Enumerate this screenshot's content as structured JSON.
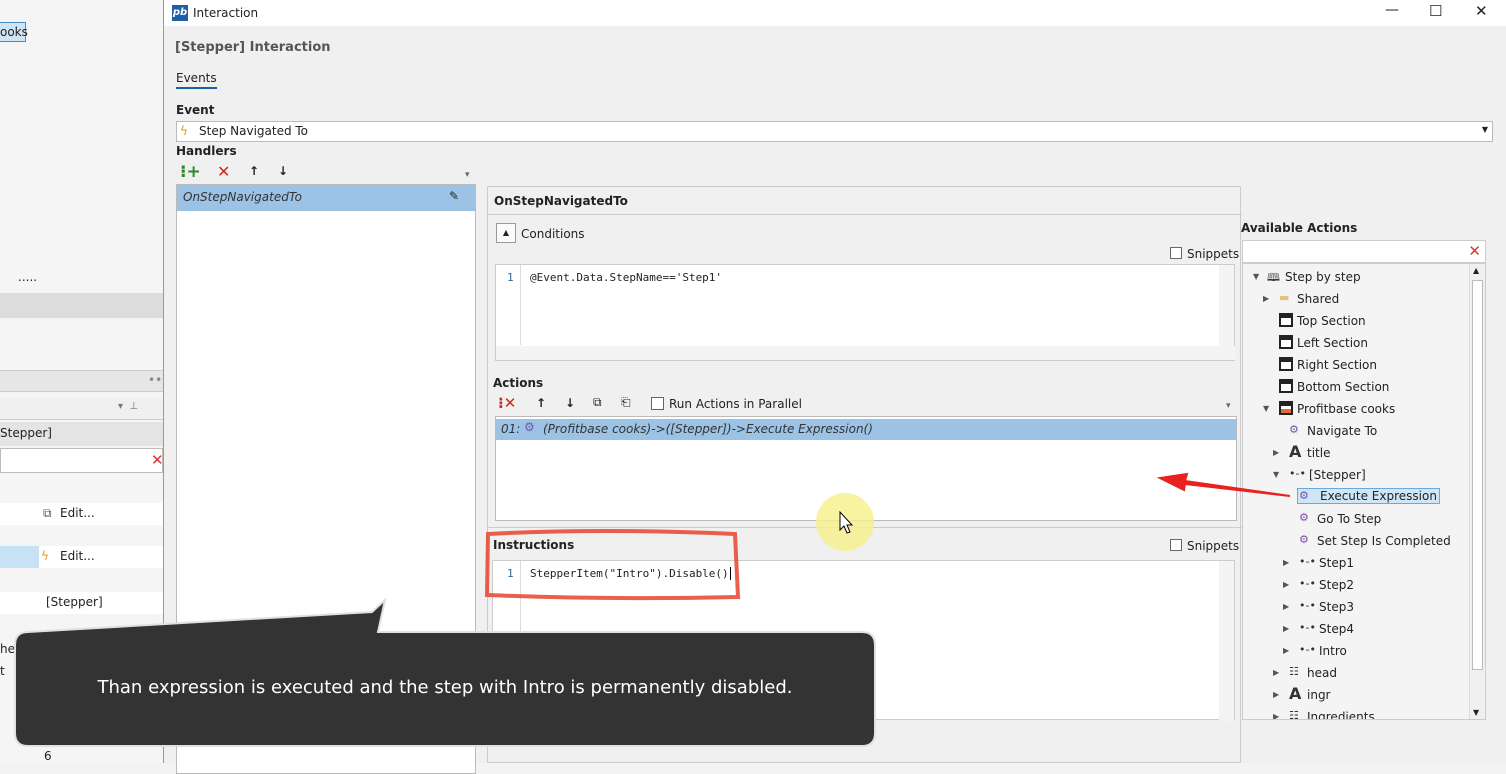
{
  "background_app": {
    "tab_label": "ooks",
    "dots": ".....",
    "grip": "••",
    "panel_header": "Stepper]",
    "property_rows": [
      {
        "value": "Edit...",
        "icon": "copy-icon"
      },
      {
        "value": "Edit...",
        "icon": "lightning-icon"
      },
      {
        "value": "[Stepper]"
      }
    ],
    "cut_labels": [
      "her",
      "t"
    ],
    "bottom_value": "6"
  },
  "window": {
    "title": "Interaction",
    "logo": "pb",
    "controls": [
      "minimize",
      "maximize",
      "close"
    ]
  },
  "dialog": {
    "heading": "[Stepper] Interaction",
    "tabs": [
      {
        "label": "Events",
        "active": true
      }
    ],
    "event": {
      "label": "Event",
      "value": "Step Navigated To",
      "icon": "lightning-icon"
    },
    "handlers": {
      "label": "Handlers",
      "toolbar": [
        "add",
        "delete",
        "move-up",
        "move-down"
      ],
      "items": [
        {
          "name": "OnStepNavigatedTo",
          "selected": true
        }
      ]
    },
    "handler_detail": {
      "title": "OnStepNavigatedTo",
      "conditions": {
        "label": "Conditions",
        "snippets_label": "Snippets",
        "snippets_checked": false,
        "lines": [
          {
            "n": "1",
            "code": "@Event.Data.StepName=='Step1'"
          }
        ]
      },
      "actions": {
        "label": "Actions",
        "run_parallel_label": "Run Actions in Parallel",
        "run_parallel_checked": false,
        "items": [
          {
            "index": "01:",
            "text": "(Profitbase cooks)->([Stepper])->Execute Expression()",
            "selected": true
          }
        ]
      },
      "instructions": {
        "label": "Instructions",
        "snippets_label": "Snippets",
        "snippets_checked": false,
        "lines": [
          {
            "n": "1",
            "code": "StepperItem(\"Intro\").Disable()"
          }
        ]
      }
    },
    "available_actions": {
      "label": "Available Actions",
      "search_value": "",
      "tree": [
        {
          "label": "Step by step",
          "level": 0,
          "toggle": "expanded",
          "icon": "book-icon"
        },
        {
          "label": "Shared",
          "level": 1,
          "toggle": "collapsed",
          "icon": "folder-icon"
        },
        {
          "label": "Top Section",
          "level": 1,
          "icon": "section-icon"
        },
        {
          "label": "Left Section",
          "level": 1,
          "icon": "section-icon"
        },
        {
          "label": "Right Section",
          "level": 1,
          "icon": "section-icon"
        },
        {
          "label": "Bottom Section",
          "level": 1,
          "icon": "section-icon"
        },
        {
          "label": "Profitbase cooks",
          "level": 1,
          "toggle": "expanded",
          "icon": "page-icon"
        },
        {
          "label": "Navigate To",
          "level": 2,
          "icon": "action-icon"
        },
        {
          "label": "title",
          "level": 2,
          "toggle": "collapsed",
          "icon": "text-icon"
        },
        {
          "label": "[Stepper]",
          "level": 2,
          "toggle": "expanded",
          "icon": "stepper-icon"
        },
        {
          "label": "Execute Expression",
          "level": 3,
          "icon": "action-icon",
          "selected": true
        },
        {
          "label": "Go To Step",
          "level": 3,
          "icon": "action-icon"
        },
        {
          "label": "Set Step Is Completed",
          "level": 3,
          "icon": "action-check-icon"
        },
        {
          "label": "Step1",
          "level": 3,
          "toggle": "collapsed",
          "icon": "stepper-icon"
        },
        {
          "label": "Step2",
          "level": 3,
          "toggle": "collapsed",
          "icon": "stepper-icon"
        },
        {
          "label": "Step3",
          "level": 3,
          "toggle": "collapsed",
          "icon": "stepper-icon"
        },
        {
          "label": "Step4",
          "level": 3,
          "toggle": "collapsed",
          "icon": "stepper-icon"
        },
        {
          "label": "Intro",
          "level": 3,
          "toggle": "collapsed",
          "icon": "stepper-icon"
        },
        {
          "label": "head",
          "level": 2,
          "toggle": "collapsed",
          "icon": "list-icon"
        },
        {
          "label": "ingr",
          "level": 2,
          "toggle": "collapsed",
          "icon": "text-icon"
        },
        {
          "label": "Ingredients",
          "level": 2,
          "toggle": "collapsed",
          "icon": "list-icon"
        }
      ]
    }
  },
  "callout": {
    "text": "Than expression is executed and the step with Intro is permanently disabled."
  },
  "colors": {
    "selection": "#9cc3e5",
    "annotation_red": "#e8432f",
    "callout_bg": "#333333",
    "cursor_highlight": "#f5f08a"
  }
}
